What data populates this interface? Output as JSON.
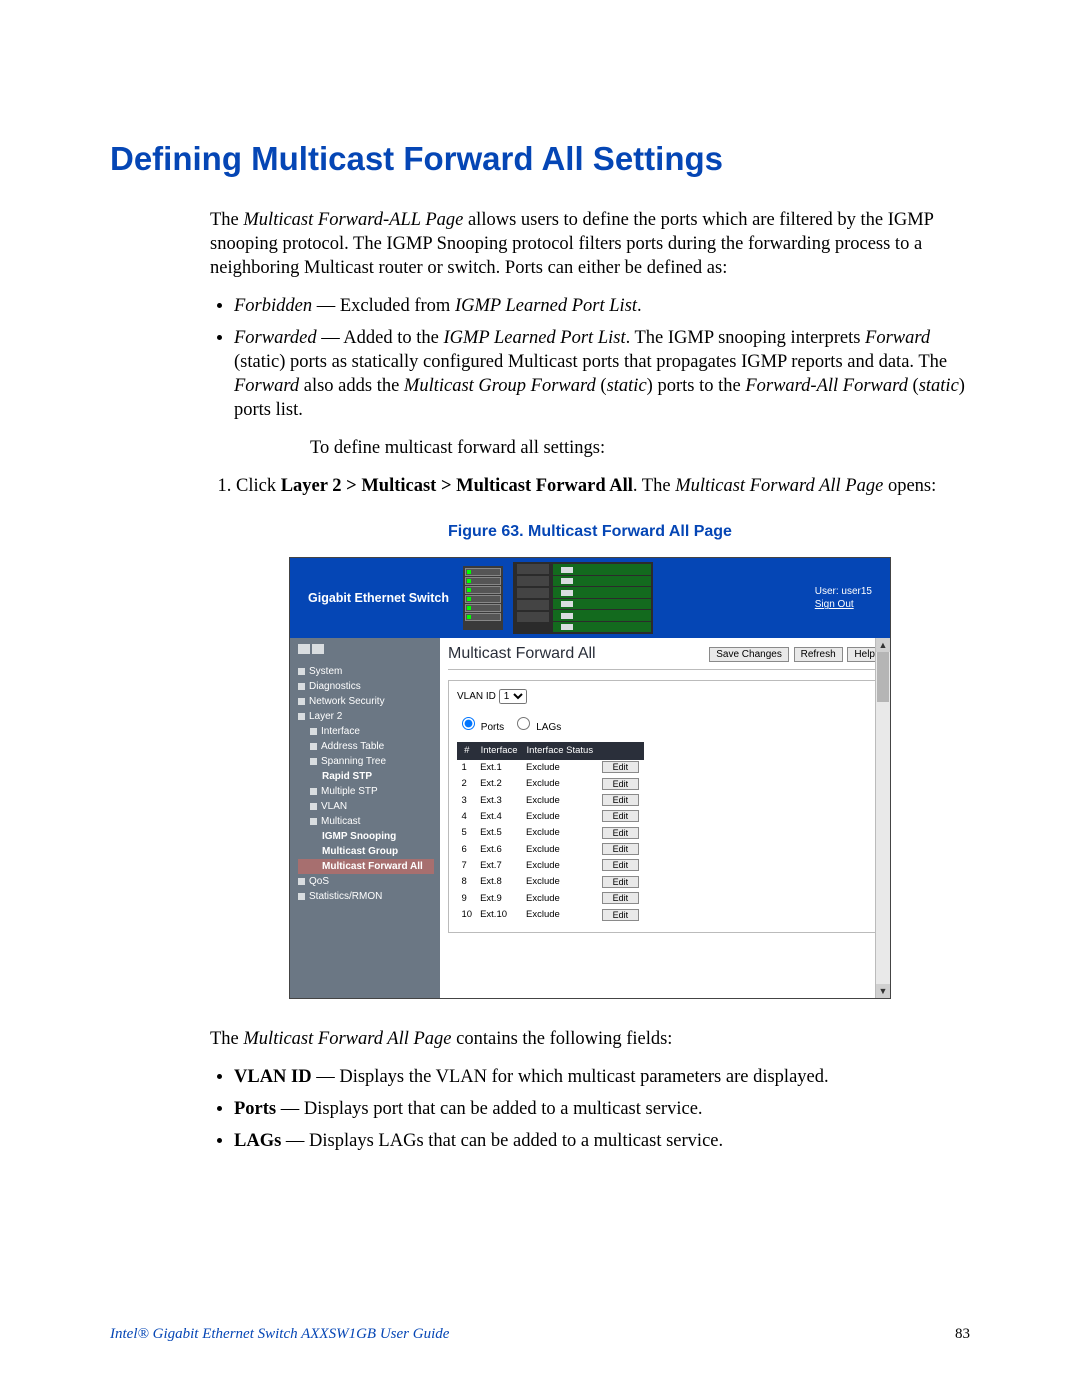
{
  "heading": "Defining Multicast Forward All Settings",
  "intro": {
    "lead": "The ",
    "page_name": "Multicast Forward-ALL Page",
    "rest": " allows users to define the ports which are filtered by the IGMP snooping protocol. The IGMP Snooping protocol filters ports during the forwarding process to a neighboring Multicast router or switch. Ports can either be defined as:"
  },
  "defs": {
    "forbidden_term": "Forbidden",
    "forbidden_desc_pre": " — Excluded from ",
    "forbidden_desc_em": "IGMP Learned Port List",
    "forbidden_desc_post": ".",
    "forwarded_term": "Forwarded",
    "forwarded_desc_pre": " — Added to the ",
    "forwarded_desc_em": "IGMP Learned Port List",
    "forwarded_desc_post1": ". The IGMP snooping interprets ",
    "forwarded_em2": "Forward",
    "forwarded_desc_post2": " (static) ports as statically configured Multicast ports that propagates IGMP reports and data. The ",
    "forwarded_em3": "Forward",
    "forwarded_desc_post3": " also adds the ",
    "forwarded_em4": "Multicast Group Forward",
    "forwarded_desc_post4": " (",
    "forwarded_em5": "static",
    "forwarded_desc_post5": ") ports to the ",
    "forwarded_em6": "Forward-All Forward",
    "forwarded_desc_post6": " (",
    "forwarded_em7": "static",
    "forwarded_desc_post7": ") ports list."
  },
  "steps_intro": "To define multicast forward all settings:",
  "step1": {
    "pre": "Click ",
    "bold": "Layer 2 > Multicast > Multicast Forward All",
    "mid": ". The ",
    "em": "Multicast Forward All Page",
    "post": " opens:"
  },
  "figure_caption": "Figure 63. Multicast Forward All Page",
  "screenshot": {
    "product": "Gigabit Ethernet Switch",
    "user_label": "User: user15",
    "signout": "Sign Out",
    "content_title": "Multicast Forward All",
    "buttons": {
      "save": "Save Changes",
      "refresh": "Refresh",
      "help": "Help"
    },
    "vlan_label": "VLAN ID",
    "vlan_value": "1",
    "radio_ports": "Ports",
    "radio_lags": "LAGs",
    "sidebar": [
      {
        "label": "System",
        "level": "l1"
      },
      {
        "label": "Diagnostics",
        "level": "l1"
      },
      {
        "label": "Network Security",
        "level": "l1"
      },
      {
        "label": "Layer 2",
        "level": "l1"
      },
      {
        "label": "Interface",
        "level": "l2"
      },
      {
        "label": "Address Table",
        "level": "l2"
      },
      {
        "label": "Spanning Tree",
        "level": "l2"
      },
      {
        "label": "Rapid STP",
        "level": "l3"
      },
      {
        "label": "Multiple STP",
        "level": "l2"
      },
      {
        "label": "VLAN",
        "level": "l2"
      },
      {
        "label": "Multicast",
        "level": "l2"
      },
      {
        "label": "IGMP Snooping",
        "level": "l3"
      },
      {
        "label": "Multicast Group",
        "level": "l3"
      },
      {
        "label": "Multicast Forward All",
        "level": "l3",
        "selected": true
      },
      {
        "label": "QoS",
        "level": "l1"
      },
      {
        "label": "Statistics/RMON",
        "level": "l1"
      }
    ],
    "table": {
      "headers": {
        "num": "#",
        "iface": "Interface",
        "status": "Interface Status"
      },
      "edit": "Edit",
      "rows": [
        {
          "n": "1",
          "iface": "Ext.1",
          "status": "Exclude"
        },
        {
          "n": "2",
          "iface": "Ext.2",
          "status": "Exclude"
        },
        {
          "n": "3",
          "iface": "Ext.3",
          "status": "Exclude"
        },
        {
          "n": "4",
          "iface": "Ext.4",
          "status": "Exclude"
        },
        {
          "n": "5",
          "iface": "Ext.5",
          "status": "Exclude"
        },
        {
          "n": "6",
          "iface": "Ext.6",
          "status": "Exclude"
        },
        {
          "n": "7",
          "iface": "Ext.7",
          "status": "Exclude"
        },
        {
          "n": "8",
          "iface": "Ext.8",
          "status": "Exclude"
        },
        {
          "n": "9",
          "iface": "Ext.9",
          "status": "Exclude"
        },
        {
          "n": "10",
          "iface": "Ext.10",
          "status": "Exclude"
        }
      ]
    }
  },
  "after_fig": {
    "lead": "The ",
    "em": "Multicast Forward All Page",
    "rest": " contains the following fields:"
  },
  "fields": {
    "vlan_b": "VLAN ID",
    "vlan_t": " — Displays the VLAN for which multicast parameters are displayed.",
    "ports_b": "Ports",
    "ports_t": " — Displays port that can be added to a multicast service.",
    "lags_b": "LAGs",
    "lags_t": " — Displays LAGs that can be added to a multicast service."
  },
  "footer": {
    "text": "Intel® Gigabit Ethernet Switch AXXSW1GB User Guide",
    "page": "83"
  }
}
